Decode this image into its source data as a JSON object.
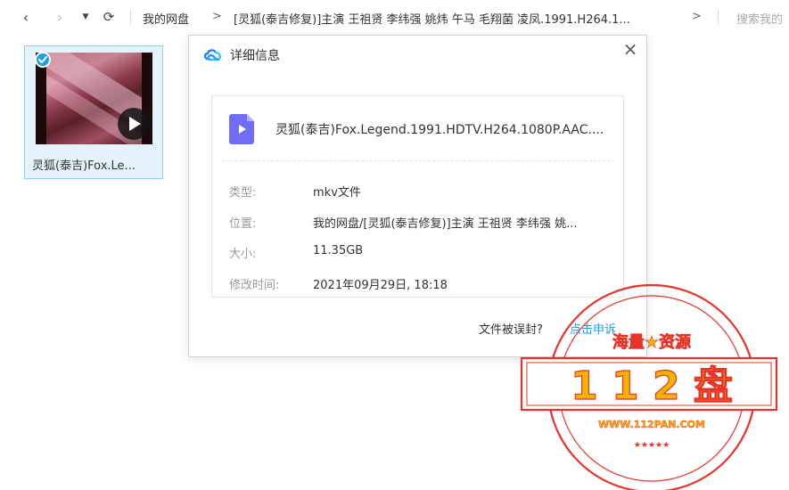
{
  "topbar": {
    "back_icon": "‹",
    "forward_icon": "›",
    "dropdown_icon": "▼",
    "refresh_icon": "⟳",
    "crumb_root": "我的网盘",
    "separator": ">",
    "crumb_folder": "[灵狐(泰吉修复)]主演 王祖贤 李纬强 姚炜 午马 毛翔菌 凌凤.1991.H264.1...",
    "search_placeholder": "搜索我的"
  },
  "file": {
    "name": "灵狐(泰吉)Fox.Le..."
  },
  "dialog": {
    "title": "详细信息",
    "close": "×",
    "filename": "灵狐(泰吉)Fox.Legend.1991.HDTV.H264.1080P.AAC....",
    "rows": [
      {
        "label": "类型:",
        "value": "mkv文件"
      },
      {
        "label": "位置:",
        "value": "我的网盘/[灵狐(泰吉修复)]主演 王祖贤 李纬强 姚..."
      },
      {
        "label": "大小:",
        "value": "11.35GB"
      },
      {
        "label": "修改时间:",
        "value": "2021年09月29日, 18:18"
      }
    ],
    "report_text": "文件被误封?",
    "report_link": "点击申诉"
  },
  "stamp": {
    "top_text": "海量★资源",
    "main_text": "1 1 2 盘",
    "url": "WWW.112PAN.COM",
    "stars": "★★★★★",
    "color": "#e8332a"
  }
}
